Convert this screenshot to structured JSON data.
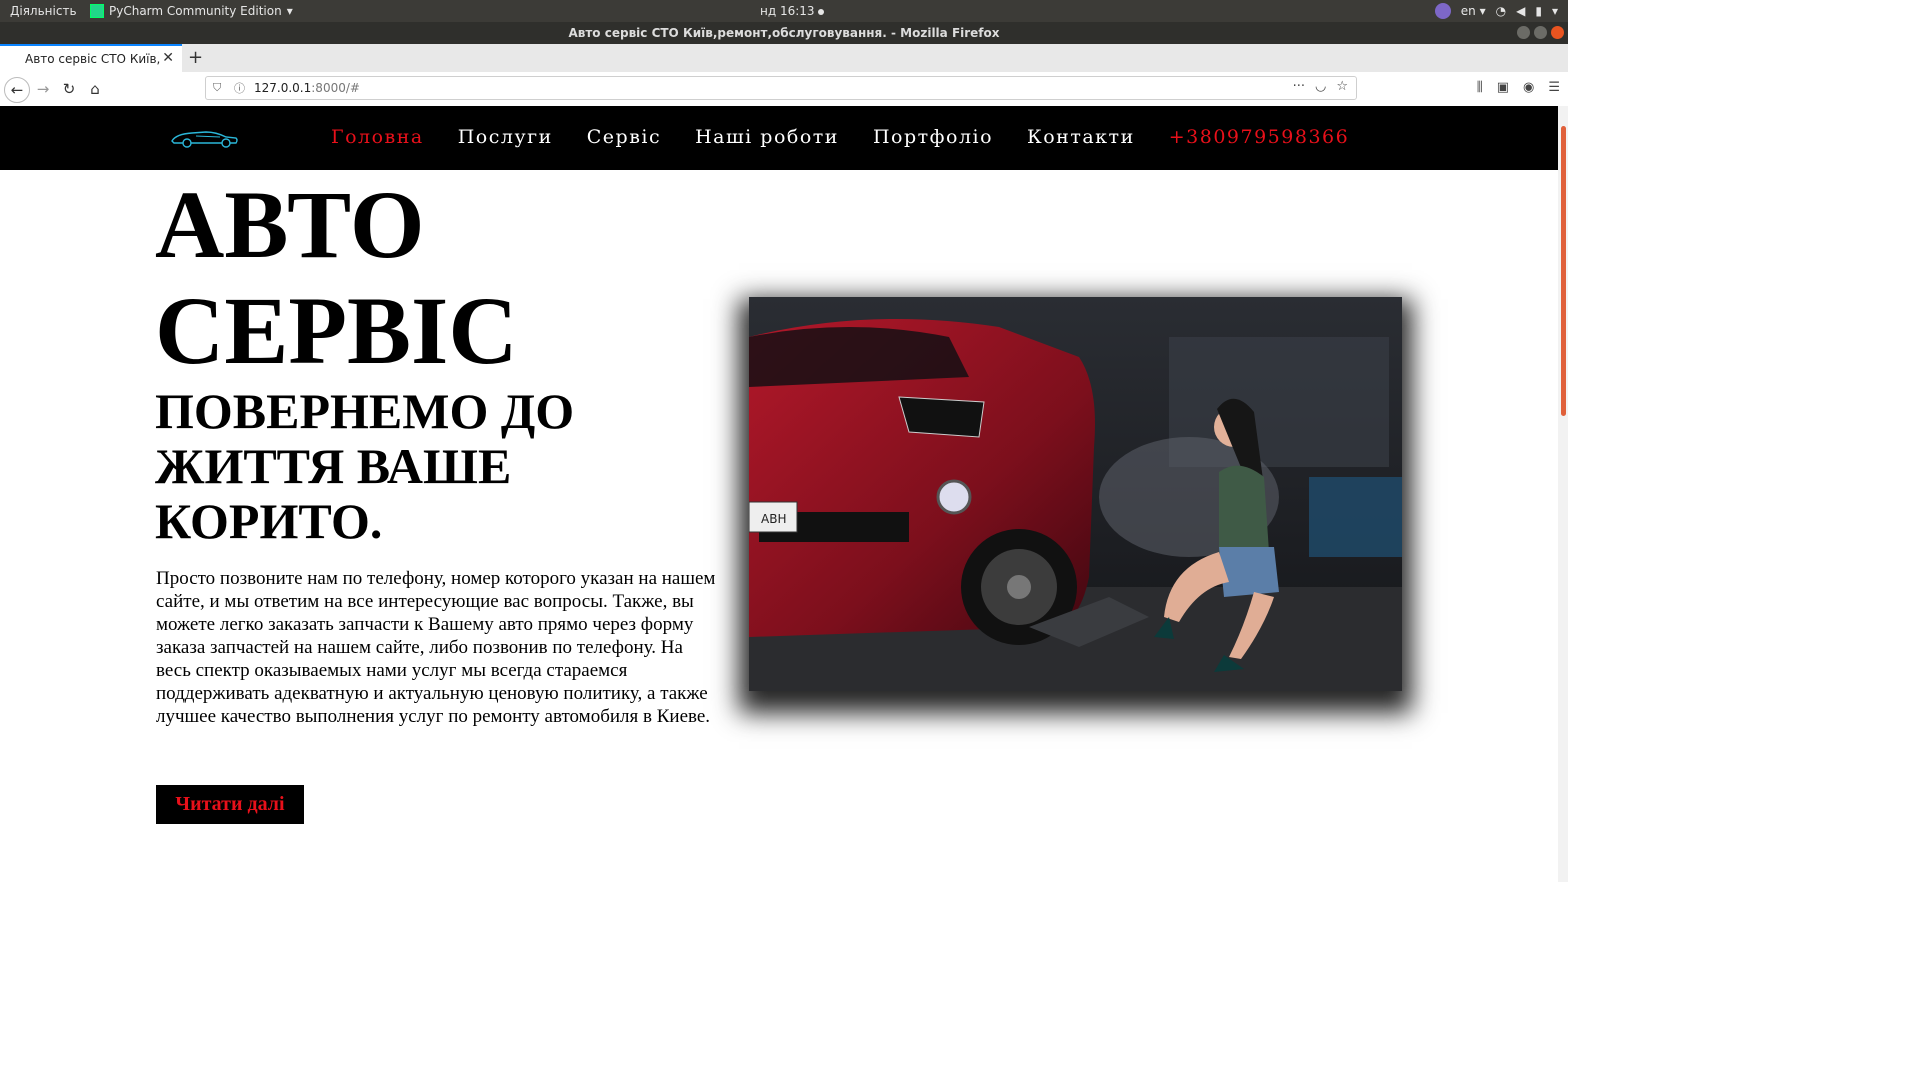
{
  "os_bar": {
    "activities": "Діяльність",
    "app_name": "PyCharm Community Edition",
    "clock": "нд 16:13",
    "lang": "en"
  },
  "window": {
    "title": "Авто сервіс СТО Київ,ремонт,обслуговування. - Mozilla Firefox"
  },
  "browser": {
    "tab_title": "Авто сервіс СТО Київ,ремонт,обслуговування.",
    "url_host": "127.0.0.1",
    "url_rest": ":8000/#"
  },
  "site": {
    "nav": [
      {
        "label": "Головна"
      },
      {
        "label": "Послуги"
      },
      {
        "label": "Сервіс"
      },
      {
        "label": "Наші роботи"
      },
      {
        "label": "Портфоліо"
      },
      {
        "label": "Контакти"
      }
    ],
    "phone": "+380979598366",
    "hero": {
      "title_line1": "АВТО",
      "title_line2": "СЕРВІС",
      "subtitle": "ПОВЕРНЕМО ДО ЖИТТЯ ВАШЕ КОРИТО.",
      "text": "Просто позвоните нам по телефону, номер которого указан на нашем сайте, и мы ответим на все интересующие вас вопросы. Также, вы можете легко заказать запчасти к Вашему авто прямо через форму заказа запчастей на нашем сайте, либо позвонив по телефону. На весь спектр оказываемых нами услуг мы всегда стараемся поддерживать адекватную и актуальную ценовую политику, а также лучшее качество выполнения услуг по ремонту автомобиля в Киеве.",
      "button": "Читати далі",
      "plate_text": "ABH"
    },
    "colors": {
      "accent": "#e8101a",
      "header_bg": "#000000"
    }
  }
}
